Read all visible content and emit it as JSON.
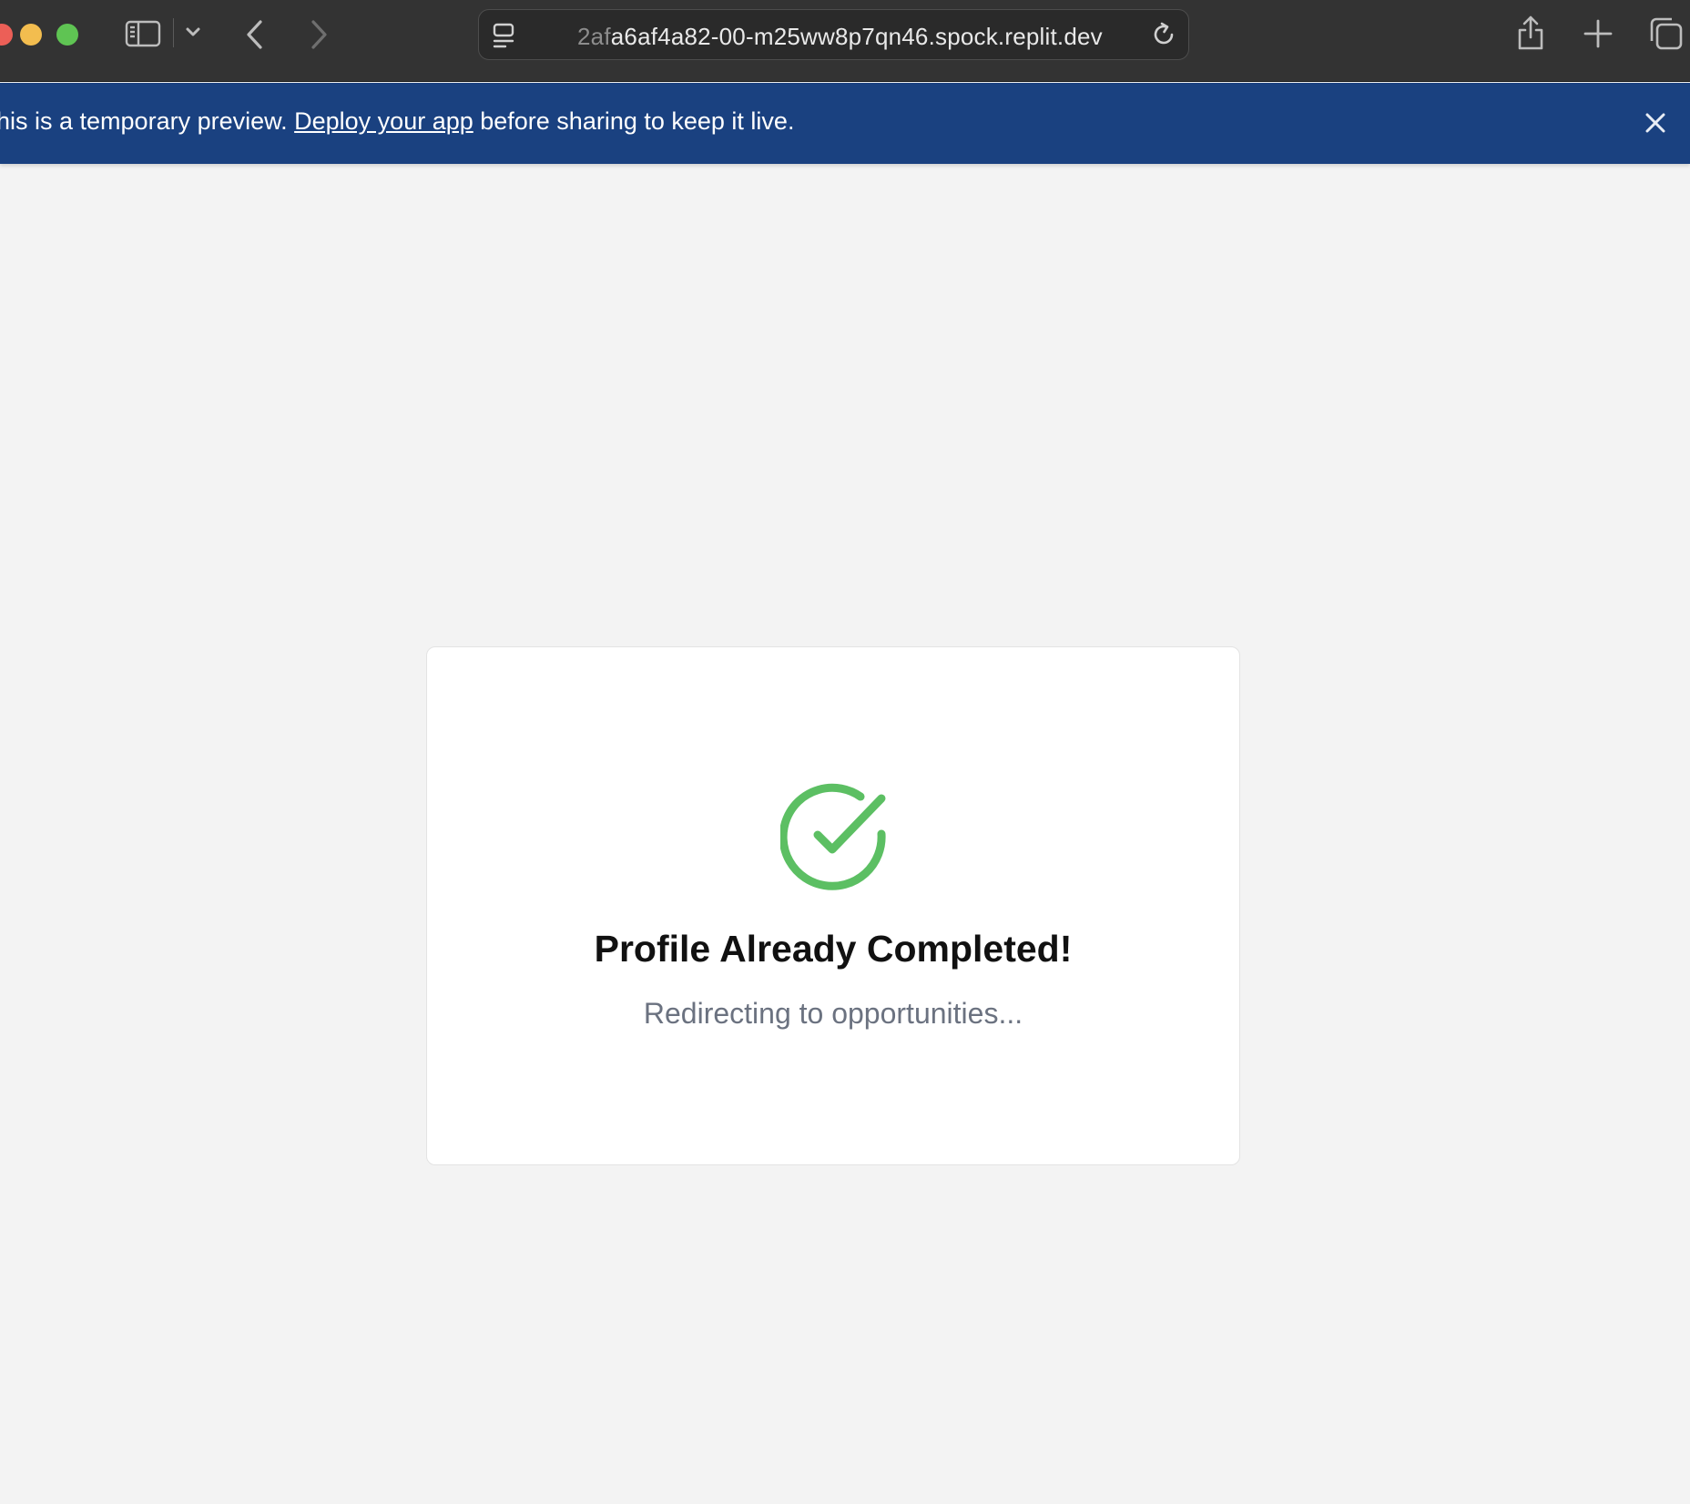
{
  "browser": {
    "url_faded": "2af",
    "url_main": "a6af4a82-00-m25ww8p7qn46.spock.replit.dev"
  },
  "banner": {
    "prefix": "his is a temporary preview. ",
    "link_text": "Deploy your app",
    "suffix": " before sharing to keep it live."
  },
  "card": {
    "title": "Profile Already Completed!",
    "subtitle": "Redirecting to opportunities..."
  },
  "colors": {
    "banner_bg": "#1a4180",
    "success_green": "#5cbf63",
    "subtitle_gray": "#6b7280"
  },
  "icons": [
    "sidebar-icon",
    "chevron-down-icon",
    "back-arrow-icon",
    "forward-arrow-icon",
    "page-menu-icon",
    "reload-icon",
    "share-icon",
    "plus-icon",
    "tabs-overview-icon",
    "close-icon",
    "check-circle-icon"
  ]
}
